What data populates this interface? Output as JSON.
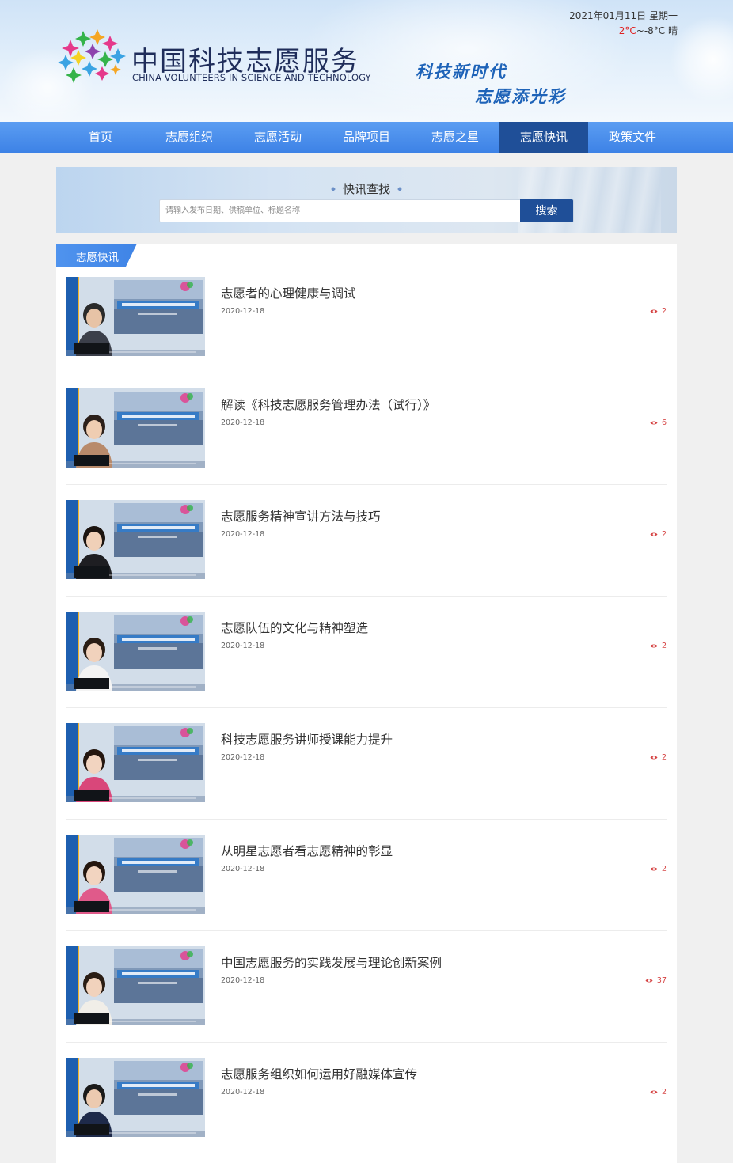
{
  "header": {
    "logo_cn": "中国科技志愿服务",
    "logo_en": "CHINA VOLUNTEERS IN SCIENCE AND TECHNOLOGY",
    "slogan_line1": "科技新时代",
    "slogan_line2": "志愿添光彩",
    "date": "2021年01月11日 星期一",
    "temp_high": "2°C",
    "temp_sep": "~",
    "temp_low": "-8°C",
    "weather": "晴"
  },
  "nav": {
    "items": [
      {
        "label": "首页"
      },
      {
        "label": "志愿组织"
      },
      {
        "label": "志愿活动"
      },
      {
        "label": "品牌项目"
      },
      {
        "label": "志愿之星"
      },
      {
        "label": "志愿快讯"
      },
      {
        "label": "政策文件"
      }
    ],
    "active": "志愿快讯"
  },
  "search": {
    "title": "快讯查找",
    "placeholder": "请输入发布日期、供稿单位、标题名称",
    "button": "搜索"
  },
  "section": {
    "title": "志愿快讯"
  },
  "news": [
    {
      "title": "志愿者的心理健康与调试",
      "date": "2020-12-18",
      "views": "2",
      "shirt": "#3b3f4a",
      "skin": "#e7c3a6",
      "hair": "#2a2a2a"
    },
    {
      "title": "解读《科技志愿服务管理办法（试行）》",
      "date": "2020-12-18",
      "views": "6",
      "shirt": "#b88a6b",
      "skin": "#efcdb2",
      "hair": "#2b1f1a"
    },
    {
      "title": "志愿服务精神宣讲方法与技巧",
      "date": "2020-12-18",
      "views": "2",
      "shirt": "#1e1e22",
      "skin": "#f0d0b8",
      "hair": "#1c1410"
    },
    {
      "title": "志愿队伍的文化与精神塑造",
      "date": "2020-12-18",
      "views": "2",
      "shirt": "#f3f3f3",
      "skin": "#f1d2bc",
      "hair": "#2a1d14"
    },
    {
      "title": "科技志愿服务讲师授课能力提升",
      "date": "2020-12-18",
      "views": "2",
      "shirt": "#d9477a",
      "skin": "#f2d4c0",
      "hair": "#24160f"
    },
    {
      "title": "从明星志愿者看志愿精神的彰显",
      "date": "2020-12-18",
      "views": "2",
      "shirt": "#e05a8a",
      "skin": "#f2d4c0",
      "hair": "#24160f"
    },
    {
      "title": "中国志愿服务的实践发展与理论创新案例",
      "date": "2020-12-18",
      "views": "37",
      "shirt": "#f1eee8",
      "skin": "#f1d2bc",
      "hair": "#2a1d14"
    },
    {
      "title": "志愿服务组织如何运用好融媒体宣传",
      "date": "2020-12-18",
      "views": "2",
      "shirt": "#1e2a4a",
      "skin": "#eccab0",
      "hair": "#1a1a1a"
    }
  ],
  "colors": {
    "nav_bg": "#3d82e6",
    "nav_active": "#1f4f98",
    "views_red": "#d64545",
    "slogan_blue": "#1e63b8"
  }
}
